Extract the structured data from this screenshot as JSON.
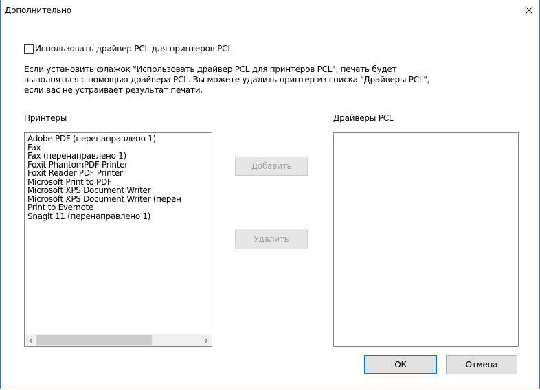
{
  "window": {
    "title": "Дополнительно",
    "close_glyph": "✕"
  },
  "use_pcl": {
    "label": "Использовать драйвер PCL для принтеров PCL",
    "checked": false
  },
  "description_lines": [
    "Если установить флажок \"Использовать драйвер PCL для принтеров PCL\", печать будет",
    "выполняться с помощью драйвера PCL. Вы можете удалить принтер из списка \"Драйверы PCL\",",
    "если вас не устраивает результат печати."
  ],
  "printers": {
    "label": "Принтеры",
    "items": [
      "Adobe PDF (перенаправлено 1)",
      "Fax",
      "Fax (перенаправлено 1)",
      "Foxit PhantomPDF Printer",
      "Foxit Reader PDF Printer",
      "Microsoft Print to PDF",
      "Microsoft XPS Document Writer",
      "Microsoft XPS Document Writer (перен",
      "Print to Evernote",
      "Snagit 11 (перенаправлено 1)"
    ],
    "scroll_left_glyph": "<",
    "scroll_right_glyph": ">"
  },
  "drivers": {
    "label": "Драйверы PCL",
    "items": []
  },
  "buttons": {
    "add": "Добавить",
    "remove": "Удалить",
    "ok": "ОК",
    "cancel": "Отмена"
  },
  "colors": {
    "window_border": "#2b79d0",
    "default_button_border": "#0078d7",
    "disabled_text": "#a0a0a0"
  },
  "icons": {
    "close": "close-icon",
    "scroll_left": "chevron-left-icon",
    "scroll_right": "chevron-right-icon"
  }
}
